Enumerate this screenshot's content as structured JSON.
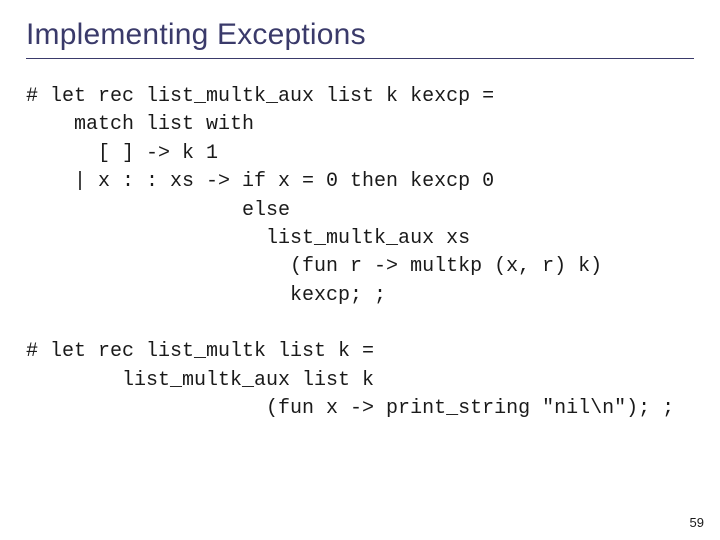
{
  "title": "Implementing Exceptions",
  "code_block_1": "# let rec list_multk_aux list k kexcp =\n    match list with\n      [ ] -> k 1\n    | x : : xs -> if x = 0 then kexcp 0\n                  else\n                    list_multk_aux xs\n                      (fun r -> multkp (x, r) k)\n                      kexcp; ;",
  "code_block_2": "# let rec list_multk list k =\n        list_multk_aux list k\n                    (fun x -> print_string \"nil\\n\"); ;",
  "page_number": "59"
}
